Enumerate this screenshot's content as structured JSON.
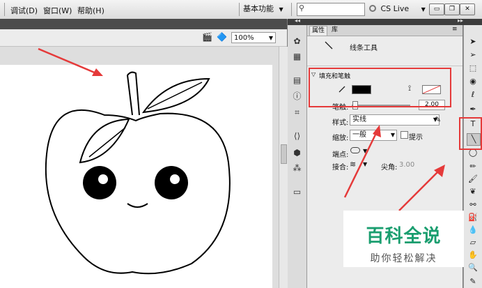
{
  "menubar": {
    "items": [
      "调试(D)",
      "窗口(W)",
      "帮助(H)"
    ],
    "workspace": "基本功能",
    "cs_live": "CS Live"
  },
  "stage": {
    "zoom": "100%"
  },
  "properties": {
    "tabs": [
      "属性",
      "库"
    ],
    "tool_name": "线条工具",
    "section_fill_stroke": "填充和笔触",
    "stroke_label": "笔触:",
    "stroke_value": "2.00",
    "style_label": "样式:",
    "style_value": "实线",
    "scale_label": "缩放:",
    "scale_value": "一般",
    "hint_label": "提示",
    "cap_label": "端点:",
    "join_label": "接合:",
    "miter_label": "尖角:",
    "miter_value": "3.00"
  },
  "colors": {
    "stroke_color": "#000000",
    "annotation_red": "#e53a3a",
    "watermark_green": "#1a9e6f"
  },
  "watermark": {
    "title": "百科全说",
    "subtitle": "助你轻松解决"
  }
}
